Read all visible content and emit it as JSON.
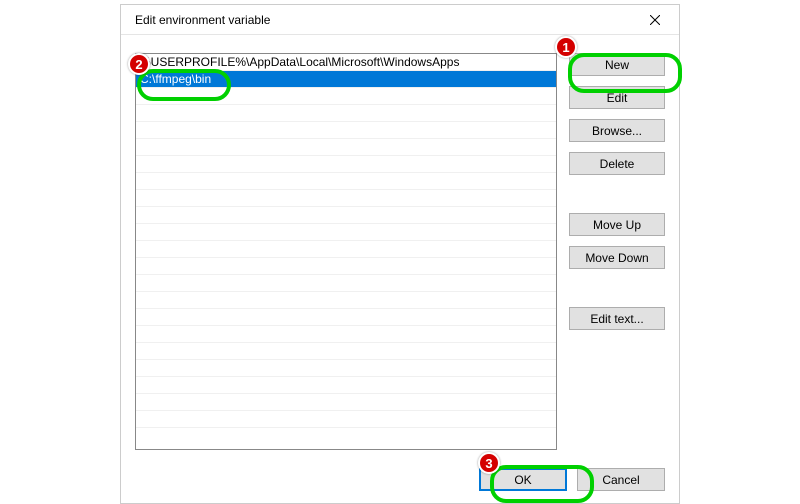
{
  "dialog": {
    "title": "Edit environment variable",
    "close_label": "Close"
  },
  "list": {
    "items": [
      {
        "text": "%USERPROFILE%\\AppData\\Local\\Microsoft\\WindowsApps",
        "selected": false
      },
      {
        "text": "C:\\ffmpeg\\bin",
        "selected": true
      }
    ]
  },
  "buttons": {
    "new": "New",
    "edit": "Edit",
    "browse": "Browse...",
    "delete": "Delete",
    "move_up": "Move Up",
    "move_down": "Move Down",
    "edit_text": "Edit text...",
    "ok": "OK",
    "cancel": "Cancel"
  },
  "annotations": {
    "step1": "1",
    "step2": "2",
    "step3": "3"
  }
}
